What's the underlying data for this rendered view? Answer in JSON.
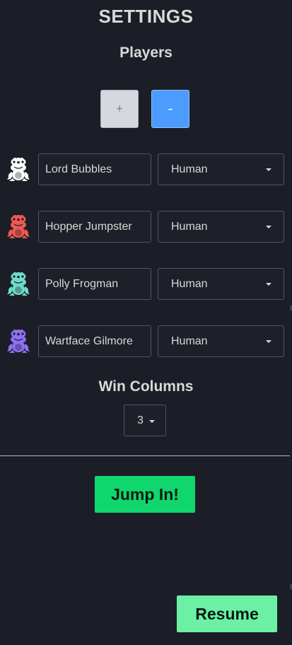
{
  "settings": {
    "title": "SETTINGS",
    "players_heading": "Players",
    "add_label": "+",
    "remove_label": "-"
  },
  "players": [
    {
      "name": "Lord Bubbles",
      "type": "Human",
      "color": "#ffffff"
    },
    {
      "name": "Hopper Jumpster",
      "type": "Human",
      "color": "#ef5a52"
    },
    {
      "name": "Polly Frogman",
      "type": "Human",
      "color": "#6fdccb"
    },
    {
      "name": "Wartface Gilmore",
      "type": "Human",
      "color": "#8f6ff0"
    }
  ],
  "win_columns": {
    "label": "Win Columns",
    "value": "3"
  },
  "actions": {
    "jump_in_label": "Jump In!",
    "resume_label": "Resume"
  },
  "colors": {
    "background": "#1b1e26",
    "accent_blue": "#4d9bff",
    "accent_green": "#0fd76e",
    "accent_green_light": "#6bf0a6"
  }
}
